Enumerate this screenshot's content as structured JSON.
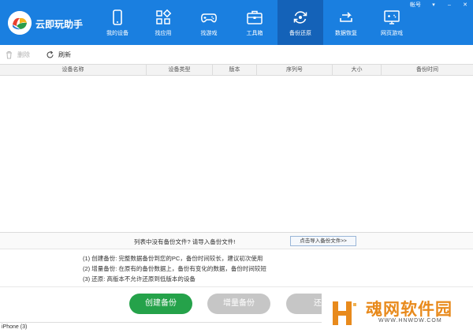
{
  "app": {
    "title": "云即玩助手",
    "window_controls": {
      "account": "帐号",
      "menu": "▾",
      "minimize": "–",
      "close": "✕"
    },
    "brand_color": "#1a7fe0"
  },
  "nav": [
    {
      "label": "我的设备",
      "icon": "phone-icon"
    },
    {
      "label": "找应用",
      "icon": "apps-grid-icon"
    },
    {
      "label": "找游戏",
      "icon": "gamepad-icon"
    },
    {
      "label": "工具箱",
      "icon": "toolbox-icon"
    },
    {
      "label": "备份还原",
      "icon": "backup-restore-icon",
      "active": true
    },
    {
      "label": "数据恢复",
      "icon": "data-recovery-icon"
    },
    {
      "label": "网页游戏",
      "icon": "web-game-icon"
    }
  ],
  "toolbar": {
    "delete_label": "删除",
    "refresh_label": "刷新"
  },
  "table": {
    "columns": [
      "设备名称",
      "设备类型",
      "版本",
      "序列号",
      "大小",
      "备份时间"
    ],
    "rows": []
  },
  "empty_notice": {
    "text": "列表中没有备份文件? 请导入备份文件!",
    "import_button": "点击导入备份文件>>"
  },
  "notes": [
    "(1) 创建备份: 完整数据备份到您的PC，备份时间较长，建议初次使用",
    "(2) 增量备份: 在原有的备份数据上，备份有变化的数据，备份时间较短",
    "(3) 还原: 高版本不允许还原到低版本的设备"
  ],
  "actions": {
    "create_label": "创建备份",
    "incremental_label": "增量备份",
    "restore_label": "还"
  },
  "status": {
    "device": "iPhone (3)"
  },
  "watermark": {
    "name": "魂网软件园",
    "url": "WWW.HNWDW.COM"
  }
}
